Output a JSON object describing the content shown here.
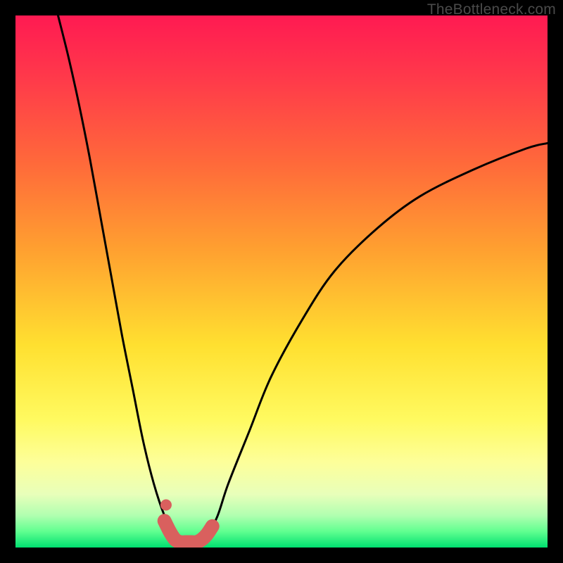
{
  "attribution": "TheBottleneck.com",
  "chart_data": {
    "type": "line",
    "title": "",
    "xlabel": "",
    "ylabel": "",
    "xlim": [
      0,
      100
    ],
    "ylim": [
      0,
      100
    ],
    "note": "Bottleneck profile chart. Steep V-shaped curves descending from top toward a minimum near x≈33 on a vertical rainbow gradient (red=high bottleneck at top, green=none at bottom). No numeric axes, ticks, or legend are rendered.",
    "series": [
      {
        "name": "left-curve",
        "x": [
          8,
          10,
          12,
          14,
          16,
          18,
          20,
          22,
          24,
          26,
          28,
          30
        ],
        "y": [
          100,
          92,
          83,
          73,
          62,
          51,
          40,
          30,
          20,
          12,
          6,
          2
        ]
      },
      {
        "name": "right-curve",
        "x": [
          36,
          38,
          40,
          44,
          48,
          54,
          60,
          68,
          76,
          86,
          96,
          100
        ],
        "y": [
          2,
          6,
          12,
          22,
          32,
          43,
          52,
          60,
          66,
          71,
          75,
          76
        ]
      },
      {
        "name": "trough-highlight",
        "x": [
          28,
          29,
          30,
          31,
          32,
          33,
          34,
          35,
          36,
          37
        ],
        "y": [
          5,
          3,
          1.5,
          1,
          1,
          1,
          1,
          1.5,
          2.5,
          4
        ]
      },
      {
        "name": "trough-dot",
        "x": [
          28.3
        ],
        "y": [
          8
        ]
      }
    ],
    "colors": {
      "curve": "#000000",
      "highlight": "#d9605e",
      "gradient_top": "#ff1a52",
      "gradient_bottom": "#00e070"
    }
  }
}
